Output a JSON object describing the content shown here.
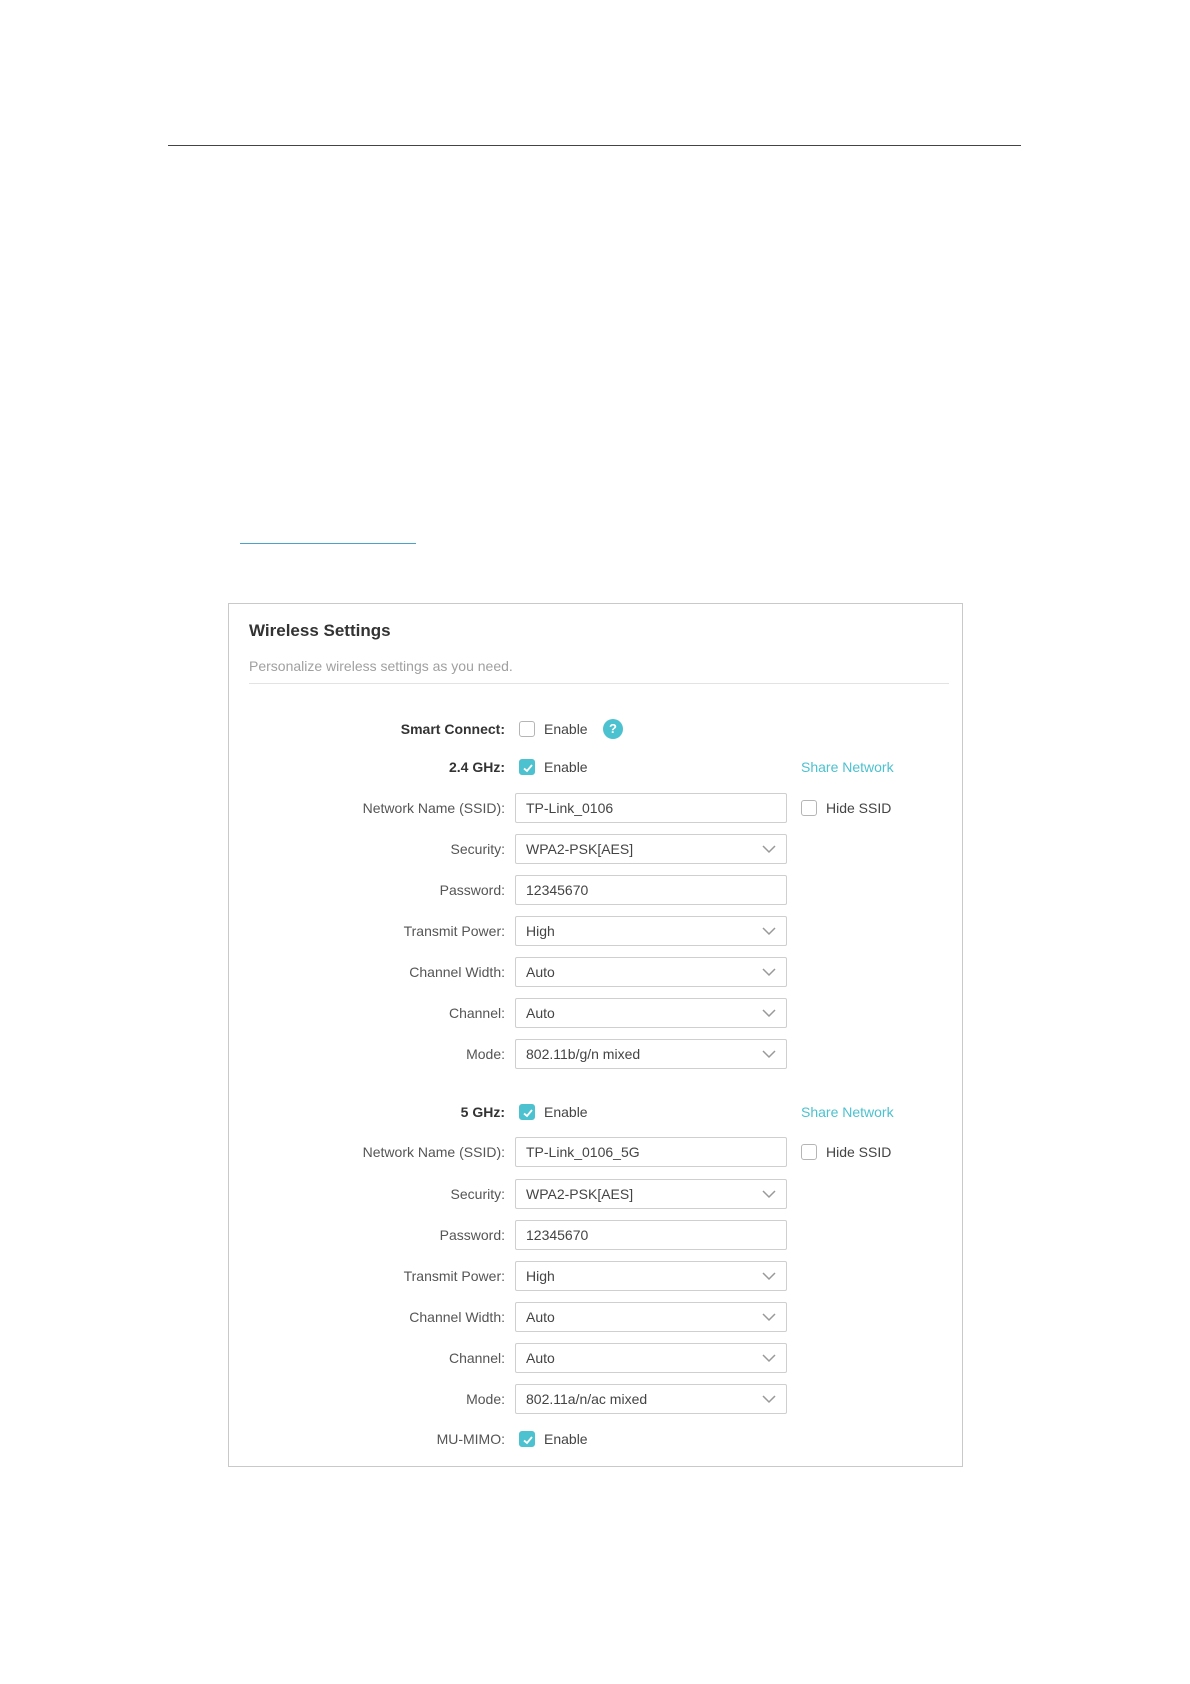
{
  "panel": {
    "title": "Wireless Settings",
    "subtitle": "Personalize wireless settings as you need."
  },
  "smart_connect": {
    "label": "Smart Connect:",
    "checkbox_label": "Enable",
    "checked": false
  },
  "band_24": {
    "label": "2.4 GHz:",
    "enable_label": "Enable",
    "enabled": true,
    "share_link": "Share Network",
    "ssid_label": "Network Name (SSID):",
    "ssid_value": "TP-Link_0106",
    "hide_ssid_label": "Hide SSID",
    "hide_ssid_checked": false,
    "security_label": "Security:",
    "security_value": "WPA2-PSK[AES]",
    "password_label": "Password:",
    "password_value": "12345670",
    "transmit_power_label": "Transmit Power:",
    "transmit_power_value": "High",
    "channel_width_label": "Channel Width:",
    "channel_width_value": "Auto",
    "channel_label": "Channel:",
    "channel_value": "Auto",
    "mode_label": "Mode:",
    "mode_value": "802.11b/g/n mixed"
  },
  "band_5": {
    "label": "5 GHz:",
    "enable_label": "Enable",
    "enabled": true,
    "share_link": "Share Network",
    "ssid_label": "Network Name (SSID):",
    "ssid_value": "TP-Link_0106_5G",
    "hide_ssid_label": "Hide SSID",
    "hide_ssid_checked": false,
    "security_label": "Security:",
    "security_value": "WPA2-PSK[AES]",
    "password_label": "Password:",
    "password_value": "12345670",
    "transmit_power_label": "Transmit Power:",
    "transmit_power_value": "High",
    "channel_width_label": "Channel Width:",
    "channel_width_value": "Auto",
    "channel_label": "Channel:",
    "channel_value": "Auto",
    "mode_label": "Mode:",
    "mode_value": "802.11a/n/ac mixed",
    "mu_mimo_label": "MU-MIMO:",
    "mu_mimo_enable_label": "Enable",
    "mu_mimo_checked": true
  },
  "colors": {
    "accent": "#4cc1cf",
    "link_underline": "#4aa3c8"
  },
  "icons": {
    "help": "question-icon",
    "dropdown": "chevron-down-icon",
    "checked": "check-icon"
  }
}
